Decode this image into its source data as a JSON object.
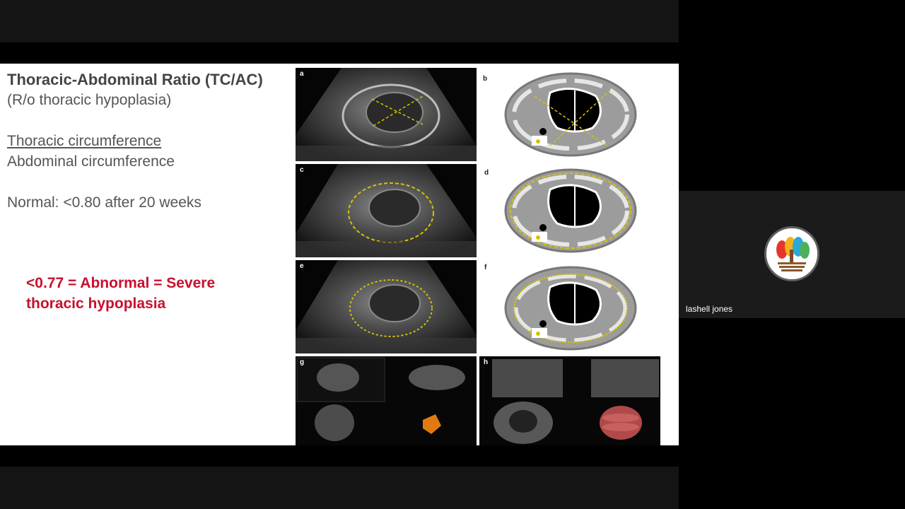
{
  "slide": {
    "title": "Thoracic-Abdominal Ratio (TC/AC)",
    "subtitle": "(R/o thoracic hypoplasia)",
    "fraction_numerator": "Thoracic circumference",
    "fraction_denominator": "Abdominal circumference",
    "normal_text": "Normal: <0.80 after 20 weeks",
    "abnormal_line1": "<0.77 = Abnormal = Severe",
    "abnormal_line2": "thoracic hypoplasia",
    "figure_panels": [
      "a",
      "b",
      "c",
      "d",
      "e",
      "f",
      "g",
      "h"
    ]
  },
  "participant": {
    "name": "lashell jones"
  },
  "colors": {
    "abnormal_text": "#c8102e",
    "measurement_line": "#d6c200"
  }
}
